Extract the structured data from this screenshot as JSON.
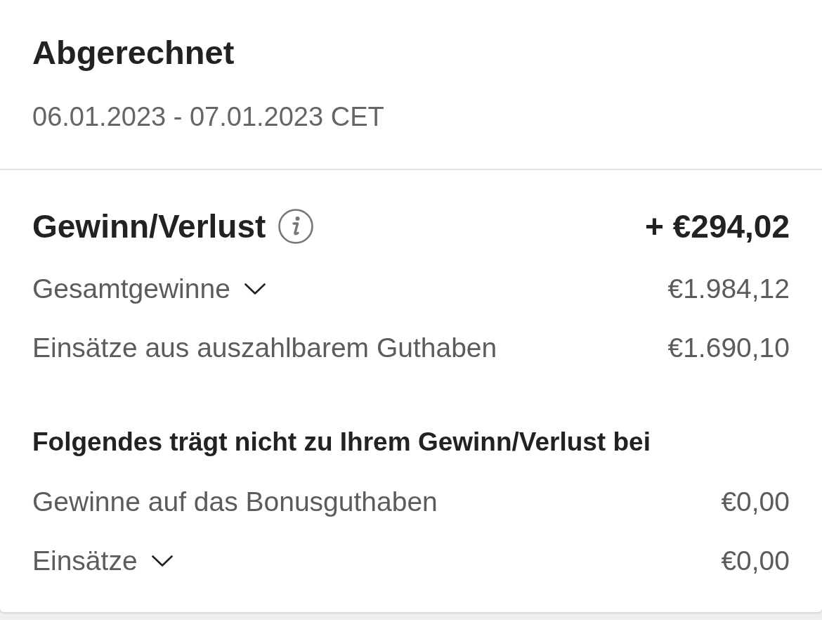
{
  "header": {
    "title": "Abgerechnet",
    "date_range": "06.01.2023 - 07.01.2023 CET"
  },
  "summary": {
    "label": "Gewinn/Verlust",
    "info": true,
    "value": "+ €294,02"
  },
  "rows": [
    {
      "kind": "expandable",
      "label": "Gesamtgewinne",
      "expanded": false,
      "value": "€1.984,12"
    },
    {
      "kind": "plain",
      "label": "Einsätze aus auszahlbarem Guthaben",
      "value": "€1.690,10"
    }
  ],
  "excluded": {
    "title": "Folgendes trägt nicht zu Ihrem Gewinn/Verlust bei",
    "rows": [
      {
        "kind": "plain",
        "label": "Gewinne auf das Bonusguthaben",
        "value": "€0,00"
      },
      {
        "kind": "expandable",
        "label": "Einsätze",
        "expanded": false,
        "value": "€0,00"
      }
    ]
  }
}
